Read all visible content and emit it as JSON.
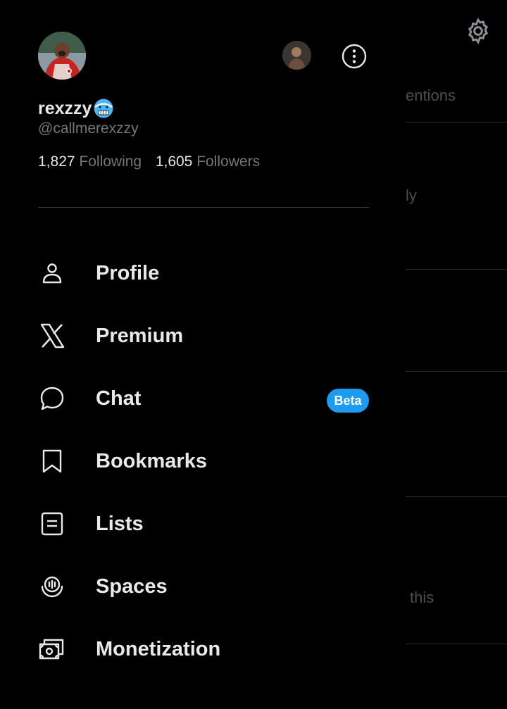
{
  "background": {
    "tab_fragment": "entions",
    "text_fragment_1": "ly",
    "text_fragment_2": "this"
  },
  "profile": {
    "name": "rexzzy",
    "handle": "@callmerexzzy",
    "following_count": "1,827",
    "following_label": "Following",
    "followers_count": "1,605",
    "followers_label": "Followers"
  },
  "menu": {
    "items": [
      {
        "label": "Profile",
        "icon": "person-icon"
      },
      {
        "label": "Premium",
        "icon": "x-logo-icon"
      },
      {
        "label": "Chat",
        "icon": "chat-bubble-icon",
        "badge": "Beta"
      },
      {
        "label": "Bookmarks",
        "icon": "bookmark-icon"
      },
      {
        "label": "Lists",
        "icon": "list-icon"
      },
      {
        "label": "Spaces",
        "icon": "spaces-icon"
      },
      {
        "label": "Monetization",
        "icon": "money-icon"
      }
    ]
  },
  "colors": {
    "background": "#000000",
    "text": "#e7e9ea",
    "secondary_text": "#71767b",
    "accent": "#1d9bf0"
  }
}
